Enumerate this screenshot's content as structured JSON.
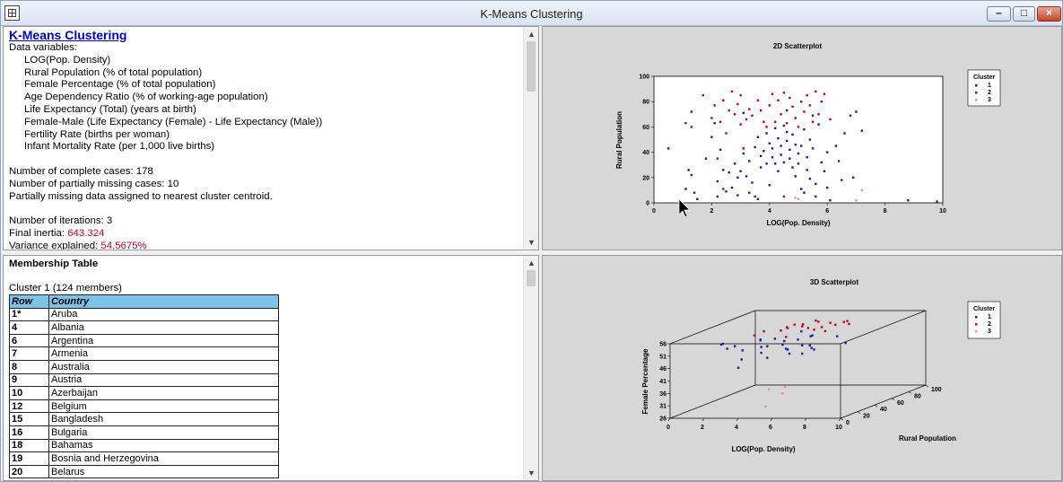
{
  "window": {
    "title": "K-Means Clustering"
  },
  "summary": {
    "heading": "K-Means Clustering",
    "data_variables_label": "Data variables:",
    "variables": [
      "LOG(Pop. Density)",
      "Rural Population (% of total population)",
      "Female Percentage (% of total population)",
      "Age Dependency Ratio (% of working-age population)",
      "Life Expectancy (Total) (years at birth)",
      "Female-Male (Life Expectancy (Female) - Life Expectancy (Male))",
      "Fertility Rate (births per woman)",
      "Infant Mortality Rate (per 1,000 live births)"
    ],
    "complete_cases": "Number of complete cases: 178",
    "partial_cases": "Number of partially missing cases: 10",
    "partial_note": "Partially missing data assigned to nearest cluster centroid.",
    "iterations": "Number of iterations: 3",
    "inertia_label": "Final inertia: ",
    "inertia_value": "643.324",
    "variance_label": "Variance explained: ",
    "variance_value": "54.5675%"
  },
  "membership": {
    "title": "Membership Table",
    "cluster_label": "Cluster 1 (124 members)",
    "headers": {
      "row": "Row",
      "country": "Country"
    },
    "rows": [
      {
        "row": "1*",
        "country": "Aruba"
      },
      {
        "row": "4",
        "country": "Albania"
      },
      {
        "row": "6",
        "country": "Argentina"
      },
      {
        "row": "7",
        "country": "Armenia"
      },
      {
        "row": "8",
        "country": "Australia"
      },
      {
        "row": "9",
        "country": "Austria"
      },
      {
        "row": "10",
        "country": "Azerbaijan"
      },
      {
        "row": "12",
        "country": "Belgium"
      },
      {
        "row": "15",
        "country": "Bangladesh"
      },
      {
        "row": "16",
        "country": "Bulgaria"
      },
      {
        "row": "18",
        "country": "Bahamas"
      },
      {
        "row": "19",
        "country": "Bosnia and Herzegovina"
      },
      {
        "row": "20",
        "country": "Belarus"
      }
    ]
  },
  "colors": {
    "cluster1": "#1a1ab0",
    "cluster2": "#c0001a",
    "cluster3": "#ee88bb"
  },
  "chart_data": [
    {
      "type": "scatter",
      "title": "2D Scatterplot",
      "xlabel": "LOG(Pop. Density)",
      "ylabel": "Rural Population",
      "xlim": [
        0,
        10
      ],
      "ylim": [
        0,
        100
      ],
      "xticks": [
        0,
        2,
        4,
        6,
        8,
        10
      ],
      "yticks": [
        0,
        20,
        40,
        60,
        80,
        100
      ],
      "legend": {
        "title": "Cluster",
        "entries": [
          "1",
          "2",
          "3"
        ],
        "placement": "right"
      },
      "series": [
        {
          "name": "1",
          "points": [
            [
              0.5,
              43
            ],
            [
              1.1,
              11
            ],
            [
              1.2,
              26
            ],
            [
              1.3,
              22
            ],
            [
              1.4,
              8
            ],
            [
              1.5,
              3
            ],
            [
              1.3,
              72
            ],
            [
              1.8,
              35
            ],
            [
              2.0,
              52
            ],
            [
              2.1,
              63
            ],
            [
              2.3,
              42
            ],
            [
              2.2,
              17
            ],
            [
              2.4,
              26
            ],
            [
              2.5,
              9
            ],
            [
              2.2,
              5
            ],
            [
              2.6,
              24
            ],
            [
              2.8,
              31
            ],
            [
              2.9,
              20
            ],
            [
              2.7,
              12
            ],
            [
              2.9,
              6
            ],
            [
              3.1,
              39
            ],
            [
              3.0,
              25
            ],
            [
              3.3,
              33
            ],
            [
              3.2,
              21
            ],
            [
              3.3,
              8
            ],
            [
              3.4,
              16
            ],
            [
              3.5,
              5
            ],
            [
              3.6,
              52
            ],
            [
              3.5,
              44
            ],
            [
              3.7,
              28
            ],
            [
              3.7,
              37
            ],
            [
              3.9,
              55
            ],
            [
              3.8,
              41
            ],
            [
              3.9,
              31
            ],
            [
              4.0,
              47
            ],
            [
              4.1,
              36
            ],
            [
              4.2,
              59
            ],
            [
              4.1,
              43
            ],
            [
              4.2,
              31
            ],
            [
              4.3,
              51
            ],
            [
              4.3,
              25
            ],
            [
              4.4,
              45
            ],
            [
              4.4,
              38
            ],
            [
              4.5,
              61
            ],
            [
              4.5,
              32
            ],
            [
              4.6,
              49
            ],
            [
              4.6,
              56
            ],
            [
              4.7,
              35
            ],
            [
              4.7,
              42
            ],
            [
              4.8,
              28
            ],
            [
              4.8,
              54
            ],
            [
              4.9,
              46
            ],
            [
              4.9,
              21
            ],
            [
              5.0,
              39
            ],
            [
              5.0,
              31
            ],
            [
              5.1,
              45
            ],
            [
              5.1,
              11
            ],
            [
              5.2,
              58
            ],
            [
              5.3,
              26
            ],
            [
              5.3,
              36
            ],
            [
              5.4,
              50
            ],
            [
              5.4,
              19
            ],
            [
              5.5,
              43
            ],
            [
              5.6,
              15
            ],
            [
              5.6,
              5
            ],
            [
              5.8,
              32
            ],
            [
              5.7,
              62
            ],
            [
              5.9,
              25
            ],
            [
              6.0,
              40
            ],
            [
              6.0,
              12
            ],
            [
              6.1,
              2
            ],
            [
              6.3,
              45
            ],
            [
              6.4,
              33
            ],
            [
              6.5,
              18
            ],
            [
              6.6,
              55
            ],
            [
              6.8,
              69
            ],
            [
              6.9,
              20
            ],
            [
              7.0,
              72
            ],
            [
              7.2,
              57
            ],
            [
              8.8,
              2
            ],
            [
              9.8,
              1
            ],
            [
              4.6,
              73
            ],
            [
              5.5,
              69
            ],
            [
              3.1,
              71
            ],
            [
              4.0,
              14
            ],
            [
              5.2,
              8
            ],
            [
              3.6,
              3
            ]
          ]
        },
        {
          "name": "2",
          "points": [
            [
              1.1,
              63
            ],
            [
              1.3,
              60
            ],
            [
              1.7,
              85
            ],
            [
              2.0,
              67
            ],
            [
              2.1,
              77
            ],
            [
              2.3,
              64
            ],
            [
              2.4,
              81
            ],
            [
              2.6,
              73
            ],
            [
              2.7,
              88
            ],
            [
              2.8,
              70
            ],
            [
              2.9,
              78
            ],
            [
              3.0,
              85
            ],
            [
              3.0,
              62
            ],
            [
              3.2,
              66
            ],
            [
              3.3,
              74
            ],
            [
              3.4,
              69
            ],
            [
              3.6,
              81
            ],
            [
              3.7,
              73
            ],
            [
              3.8,
              64
            ],
            [
              3.9,
              60
            ],
            [
              4.0,
              77
            ],
            [
              4.1,
              86
            ],
            [
              4.2,
              64
            ],
            [
              4.3,
              81
            ],
            [
              4.4,
              70
            ],
            [
              4.5,
              87
            ],
            [
              4.6,
              63
            ],
            [
              4.7,
              83
            ],
            [
              4.8,
              76
            ],
            [
              4.9,
              67
            ],
            [
              5.0,
              60
            ],
            [
              5.1,
              80
            ],
            [
              5.2,
              72
            ],
            [
              5.3,
              85
            ],
            [
              5.4,
              77
            ],
            [
              5.5,
              64
            ],
            [
              5.6,
              88
            ],
            [
              5.7,
              70
            ],
            [
              5.8,
              80
            ],
            [
              5.9,
              86
            ],
            [
              6.1,
              66
            ],
            [
              2.2,
              35
            ],
            [
              3.1,
              43
            ],
            [
              2.5,
              55
            ],
            [
              4.5,
              5
            ],
            [
              2.4,
              11
            ]
          ]
        },
        {
          "name": "3",
          "points": [
            [
              4.9,
              4
            ],
            [
              5.0,
              3
            ],
            [
              7.2,
              10
            ],
            [
              7.0,
              2
            ]
          ]
        }
      ]
    },
    {
      "type": "scatter",
      "title": "3D Scatterplot",
      "xlabel": "LOG(Pop. Density)",
      "ylabel": "Rural Population",
      "zlabel": "Female Percentage",
      "xlim": [
        0,
        10
      ],
      "ylim": [
        0,
        100
      ],
      "zlim": [
        26,
        56
      ],
      "xticks": [
        0,
        2,
        4,
        6,
        8,
        10
      ],
      "yticks": [
        0,
        20,
        40,
        60,
        80,
        100
      ],
      "zticks": [
        26,
        31,
        36,
        41,
        46,
        51,
        56
      ],
      "legend": {
        "title": "Cluster",
        "entries": [
          "1",
          "2",
          "3"
        ],
        "placement": "right"
      },
      "series": [
        {
          "name": "1",
          "points": [
            [
              2.0,
              20,
              53
            ],
            [
              2.3,
              30,
              51
            ],
            [
              2.6,
              15,
              52
            ],
            [
              3.0,
              25,
              50
            ],
            [
              3.3,
              40,
              52
            ],
            [
              3.6,
              35,
              50
            ],
            [
              3.9,
              45,
              52
            ],
            [
              4.2,
              30,
              51
            ],
            [
              4.5,
              42,
              50
            ],
            [
              4.8,
              38,
              52
            ],
            [
              5.0,
              50,
              51
            ],
            [
              5.3,
              30,
              50
            ],
            [
              5.6,
              55,
              52
            ],
            [
              5.9,
              20,
              51
            ],
            [
              6.2,
              40,
              50
            ],
            [
              6.5,
              25,
              52
            ],
            [
              6.8,
              60,
              51
            ],
            [
              7.0,
              15,
              50
            ],
            [
              3.2,
              20,
              47
            ],
            [
              4.1,
              25,
              49
            ],
            [
              5.5,
              30,
              48
            ],
            [
              6.7,
              35,
              49
            ],
            [
              7.8,
              10,
              53
            ],
            [
              3.5,
              10,
              45
            ],
            [
              4.7,
              60,
              53
            ],
            [
              6.0,
              45,
              53
            ],
            [
              2.8,
              50,
              51
            ],
            [
              5.2,
              10,
              49
            ],
            [
              8.3,
              40,
              51
            ],
            [
              1.6,
              30,
              52
            ]
          ]
        },
        {
          "name": "2",
          "points": [
            [
              2.5,
              60,
              53
            ],
            [
              3.0,
              70,
              52
            ],
            [
              3.3,
              80,
              53
            ],
            [
              3.6,
              65,
              54
            ],
            [
              4.0,
              75,
              53
            ],
            [
              4.3,
              85,
              54
            ],
            [
              4.6,
              70,
              53
            ],
            [
              4.9,
              80,
              52
            ],
            [
              5.2,
              65,
              53
            ],
            [
              5.5,
              78,
              54
            ],
            [
              5.8,
              88,
              53
            ],
            [
              6.1,
              72,
              54
            ],
            [
              6.4,
              82,
              53
            ],
            [
              3.8,
              62,
              54
            ],
            [
              4.5,
              66,
              55
            ],
            [
              5.0,
              74,
              55
            ],
            [
              5.7,
              68,
              52
            ],
            [
              6.6,
              76,
              55
            ],
            [
              2.2,
              55,
              52
            ],
            [
              3.9,
              58,
              51
            ]
          ]
        },
        {
          "name": "3",
          "points": [
            [
              6.5,
              5,
              38
            ],
            [
              4.8,
              20,
              35
            ],
            [
              5.1,
              30,
              32
            ],
            [
              4.6,
              20,
              28
            ]
          ]
        }
      ]
    }
  ]
}
